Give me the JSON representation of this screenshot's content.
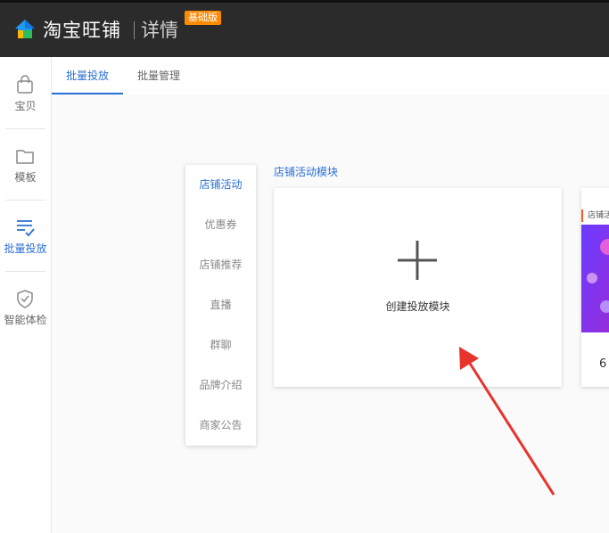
{
  "app": {
    "brand_name": "淘宝旺铺",
    "section": "详情",
    "edition_badge": "基础版"
  },
  "sidebar": {
    "items": [
      {
        "label": "宝贝",
        "icon": "bag-icon",
        "active": false
      },
      {
        "label": "模板",
        "icon": "folder-icon",
        "active": false
      },
      {
        "label": "批量投放",
        "icon": "list-check-icon",
        "active": true
      },
      {
        "label": "智能体检",
        "icon": "shield-check-icon",
        "active": false
      }
    ]
  },
  "tabs": [
    {
      "label": "批量投放",
      "active": true
    },
    {
      "label": "批量管理",
      "active": false
    }
  ],
  "module_menu": {
    "items": [
      {
        "label": "店铺活动",
        "active": true
      },
      {
        "label": "优惠券",
        "active": false
      },
      {
        "label": "店铺推荐",
        "active": false
      },
      {
        "label": "直播",
        "active": false
      },
      {
        "label": "群聊",
        "active": false
      },
      {
        "label": "品牌介绍",
        "active": false
      },
      {
        "label": "商家公告",
        "active": false
      }
    ]
  },
  "main": {
    "section_title": "店铺活动模块",
    "create_card": {
      "label": "创建投放模块",
      "icon": "plus-icon"
    },
    "template_card": {
      "tag": "店铺活",
      "count": "6"
    }
  },
  "colors": {
    "accent": "#2a6fd6",
    "topbar": "#2b2b2b",
    "badge": "#ff8a00",
    "arrow": "#e8322c"
  }
}
